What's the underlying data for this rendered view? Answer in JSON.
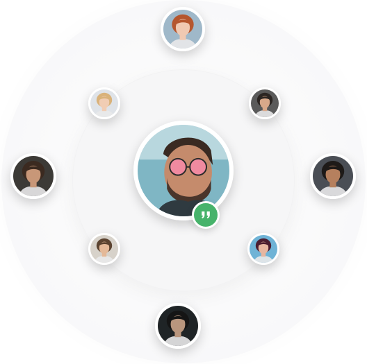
{
  "colors": {
    "background": "#ffffff",
    "ring": "#f6f6f7",
    "badge": "#47b36b",
    "badge_glyph": "#ffffff"
  },
  "center_avatar": {
    "icon": "user-photo-man-sunglasses",
    "background": "#7fb6c4",
    "skin": "#c58b6c",
    "hair": "#3a2a22",
    "accent": "#f08aa0"
  },
  "badge": {
    "icon": "quote-icon"
  },
  "orbit_avatars": [
    {
      "id": "top",
      "icon": "user-photo-woman-redhead",
      "background": "#9fb8c9",
      "skin": "#f0c9b2",
      "hair": "#b5562e"
    },
    {
      "id": "upper-left",
      "icon": "user-photo-woman-blonde",
      "background": "#dfe3e8",
      "skin": "#f1cdb4",
      "hair": "#d9b27a"
    },
    {
      "id": "upper-right",
      "icon": "user-photo-man-glasses",
      "background": "#5a5a5a",
      "skin": "#d9a98a",
      "hair": "#2b2522"
    },
    {
      "id": "left",
      "icon": "user-photo-man-curly",
      "background": "#3c3a36",
      "skin": "#c89778",
      "hair": "#3b2a20"
    },
    {
      "id": "right",
      "icon": "user-photo-man-smiling",
      "background": "#4a4e55",
      "skin": "#b6805e",
      "hair": "#1e1a18"
    },
    {
      "id": "lower-left",
      "icon": "user-photo-man-young",
      "background": "#d7d2ca",
      "skin": "#e4b998",
      "hair": "#5b4330"
    },
    {
      "id": "lower-right",
      "icon": "user-photo-woman-darkhair",
      "background": "#6fb3d6",
      "skin": "#e7b6a0",
      "hair": "#4b1d30"
    },
    {
      "id": "bottom",
      "icon": "user-photo-man-dark",
      "background": "#1f2426",
      "skin": "#b9967e",
      "hair": "#151515"
    }
  ]
}
